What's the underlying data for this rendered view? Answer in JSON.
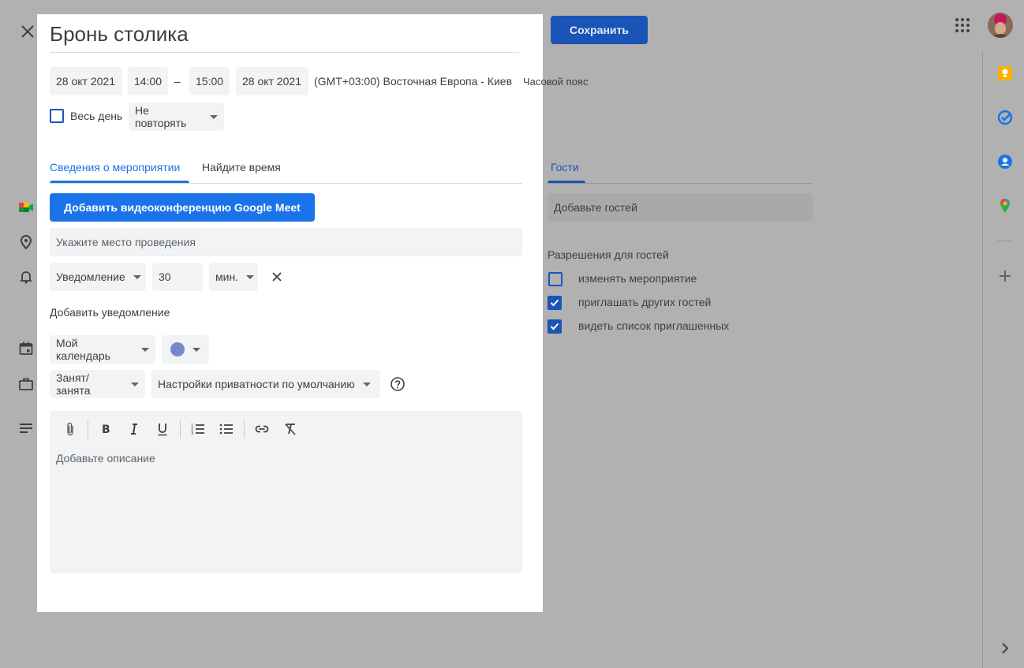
{
  "header": {
    "close_icon": "close-icon",
    "save_label": "Сохранить",
    "apps_icon": "apps-grid-icon"
  },
  "event": {
    "title": "Бронь столика",
    "start_date": "28 окт 2021",
    "start_time": "14:00",
    "dash": "–",
    "end_time": "15:00",
    "end_date": "28 окт 2021",
    "timezone": "(GMT+03:00) Восточная Европа - Киев",
    "timezone_link": "Часовой пояс",
    "all_day_label": "Весь день",
    "repeat": "Не повторять"
  },
  "tabs": {
    "details": "Сведения о мероприятии",
    "find_time": "Найдите время",
    "guests": "Гости"
  },
  "details": {
    "meet_button": "Добавить видеоконференцию Google Meet",
    "location_placeholder": "Укажите место проведения",
    "notification_type": "Уведомление",
    "notification_value": "30",
    "notification_unit": "мин.",
    "add_notification": "Добавить уведомление",
    "calendar": "Мой календарь",
    "calendar_color": "#7986cb",
    "busy_status": "Занят/занята",
    "privacy": "Настройки приватности по умолчанию",
    "description_placeholder": "Добавьте описание"
  },
  "guests": {
    "add_placeholder": "Добавьте гостей",
    "permissions_title": "Разрешения для гостей",
    "permissions": [
      {
        "label": "изменять мероприятие",
        "checked": false
      },
      {
        "label": "приглашать других гостей",
        "checked": true
      },
      {
        "label": "видеть список приглашенных",
        "checked": true
      }
    ]
  },
  "colors": {
    "primary": "#1a73e8",
    "save_button": "#1a54b7"
  }
}
